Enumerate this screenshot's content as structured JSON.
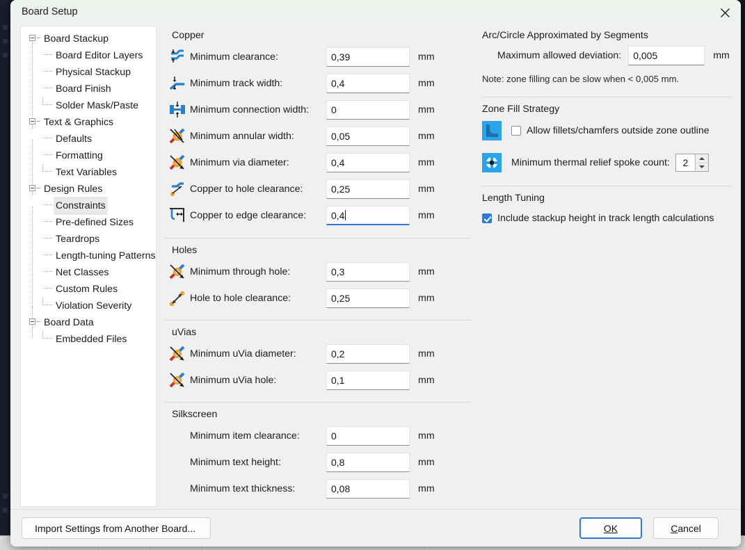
{
  "window": {
    "title": "Board Setup",
    "close_icon": "close-icon"
  },
  "sidebar": {
    "nodes": [
      {
        "label": "Board Stackup",
        "level": 0,
        "expanded": true,
        "selected": false
      },
      {
        "label": "Board Editor Layers",
        "level": 1,
        "expanded": false,
        "selected": false
      },
      {
        "label": "Physical Stackup",
        "level": 1,
        "expanded": false,
        "selected": false
      },
      {
        "label": "Board Finish",
        "level": 1,
        "expanded": false,
        "selected": false
      },
      {
        "label": "Solder Mask/Paste",
        "level": 1,
        "expanded": false,
        "selected": false
      },
      {
        "label": "Text & Graphics",
        "level": 0,
        "expanded": true,
        "selected": false
      },
      {
        "label": "Defaults",
        "level": 1,
        "expanded": false,
        "selected": false
      },
      {
        "label": "Formatting",
        "level": 1,
        "expanded": false,
        "selected": false
      },
      {
        "label": "Text Variables",
        "level": 1,
        "expanded": false,
        "selected": false
      },
      {
        "label": "Design Rules",
        "level": 0,
        "expanded": true,
        "selected": false
      },
      {
        "label": "Constraints",
        "level": 1,
        "expanded": false,
        "selected": true
      },
      {
        "label": "Pre-defined Sizes",
        "level": 1,
        "expanded": false,
        "selected": false
      },
      {
        "label": "Teardrops",
        "level": 1,
        "expanded": false,
        "selected": false
      },
      {
        "label": "Length-tuning Patterns",
        "level": 1,
        "expanded": false,
        "selected": false
      },
      {
        "label": "Net Classes",
        "level": 1,
        "expanded": false,
        "selected": false
      },
      {
        "label": "Custom Rules",
        "level": 1,
        "expanded": false,
        "selected": false
      },
      {
        "label": "Violation Severity",
        "level": 1,
        "expanded": false,
        "selected": false
      },
      {
        "label": "Board Data",
        "level": 0,
        "expanded": true,
        "selected": false
      },
      {
        "label": "Embedded Files",
        "level": 1,
        "expanded": false,
        "selected": false
      }
    ]
  },
  "copper": {
    "group_title": "Copper",
    "fields": [
      {
        "icon": "min-clearance-icon",
        "label": "Minimum clearance:",
        "value": "0,39",
        "unit": "mm",
        "focused": false
      },
      {
        "icon": "min-track-width-icon",
        "label": "Minimum track width:",
        "value": "0,4",
        "unit": "mm",
        "focused": false
      },
      {
        "icon": "min-connection-width-icon",
        "label": "Minimum connection width:",
        "value": "0",
        "unit": "mm",
        "focused": false
      },
      {
        "icon": "min-annular-width-icon",
        "label": "Minimum annular width:",
        "value": "0,05",
        "unit": "mm",
        "focused": false
      },
      {
        "icon": "min-via-diameter-icon",
        "label": "Minimum via diameter:",
        "value": "0,4",
        "unit": "mm",
        "focused": false
      },
      {
        "icon": "copper-to-hole-icon",
        "label": "Copper to hole clearance:",
        "value": "0,25",
        "unit": "mm",
        "focused": false
      },
      {
        "icon": "copper-to-edge-icon",
        "label": "Copper to edge clearance:",
        "value": "0,4",
        "unit": "mm",
        "focused": true
      }
    ]
  },
  "holes": {
    "group_title": "Holes",
    "fields": [
      {
        "icon": "min-through-hole-icon",
        "label": "Minimum through hole:",
        "value": "0,3",
        "unit": "mm",
        "focused": false
      },
      {
        "icon": "hole-to-hole-icon",
        "label": "Hole to hole clearance:",
        "value": "0,25",
        "unit": "mm",
        "focused": false
      }
    ]
  },
  "uvias": {
    "group_title": "uVias",
    "fields": [
      {
        "icon": "min-uvia-diameter-icon",
        "label": "Minimum uVia diameter:",
        "value": "0,2",
        "unit": "mm",
        "focused": false
      },
      {
        "icon": "min-uvia-hole-icon",
        "label": "Minimum uVia hole:",
        "value": "0,1",
        "unit": "mm",
        "focused": false
      }
    ]
  },
  "silkscreen": {
    "group_title": "Silkscreen",
    "fields": [
      {
        "icon": "none",
        "label": "Minimum item clearance:",
        "value": "0",
        "unit": "mm",
        "focused": false
      },
      {
        "icon": "none",
        "label": "Minimum text height:",
        "value": "0,8",
        "unit": "mm",
        "focused": false
      },
      {
        "icon": "none",
        "label": "Minimum text thickness:",
        "value": "0,08",
        "unit": "mm",
        "focused": false
      }
    ]
  },
  "arc_circle": {
    "group_title": "Arc/Circle Approximated by Segments",
    "deviation_label": "Maximum allowed deviation:",
    "deviation_value": "0,005",
    "deviation_unit": "mm",
    "note": "Note: zone filling can be slow when < 0,005 mm."
  },
  "zone_fill": {
    "group_title": "Zone Fill Strategy",
    "allow_fillets_label": "Allow fillets/chamfers outside zone outline",
    "allow_fillets_checked": false,
    "allow_fillets_icon": "fillet-corner-icon",
    "spoke_count_label": "Minimum thermal relief spoke count:",
    "spoke_count_value": "2",
    "spoke_count_icon": "thermal-relief-icon"
  },
  "length_tuning": {
    "group_title": "Length Tuning",
    "include_stackup_label": "Include stackup height in track length calculations",
    "include_stackup_checked": true
  },
  "footer": {
    "import_label": "Import Settings from Another Board...",
    "ok_label": "OK",
    "ok_mnemonic": "O",
    "cancel_label": "Cancel",
    "cancel_mnemonic": "C"
  },
  "colors": {
    "accent": "#2f7bd4",
    "icon_blue": "#2a7fc9",
    "icon_orange": "#f0a030",
    "panel_bg": "#f0f0f0",
    "titlebar_bg": "#eef3ed"
  }
}
